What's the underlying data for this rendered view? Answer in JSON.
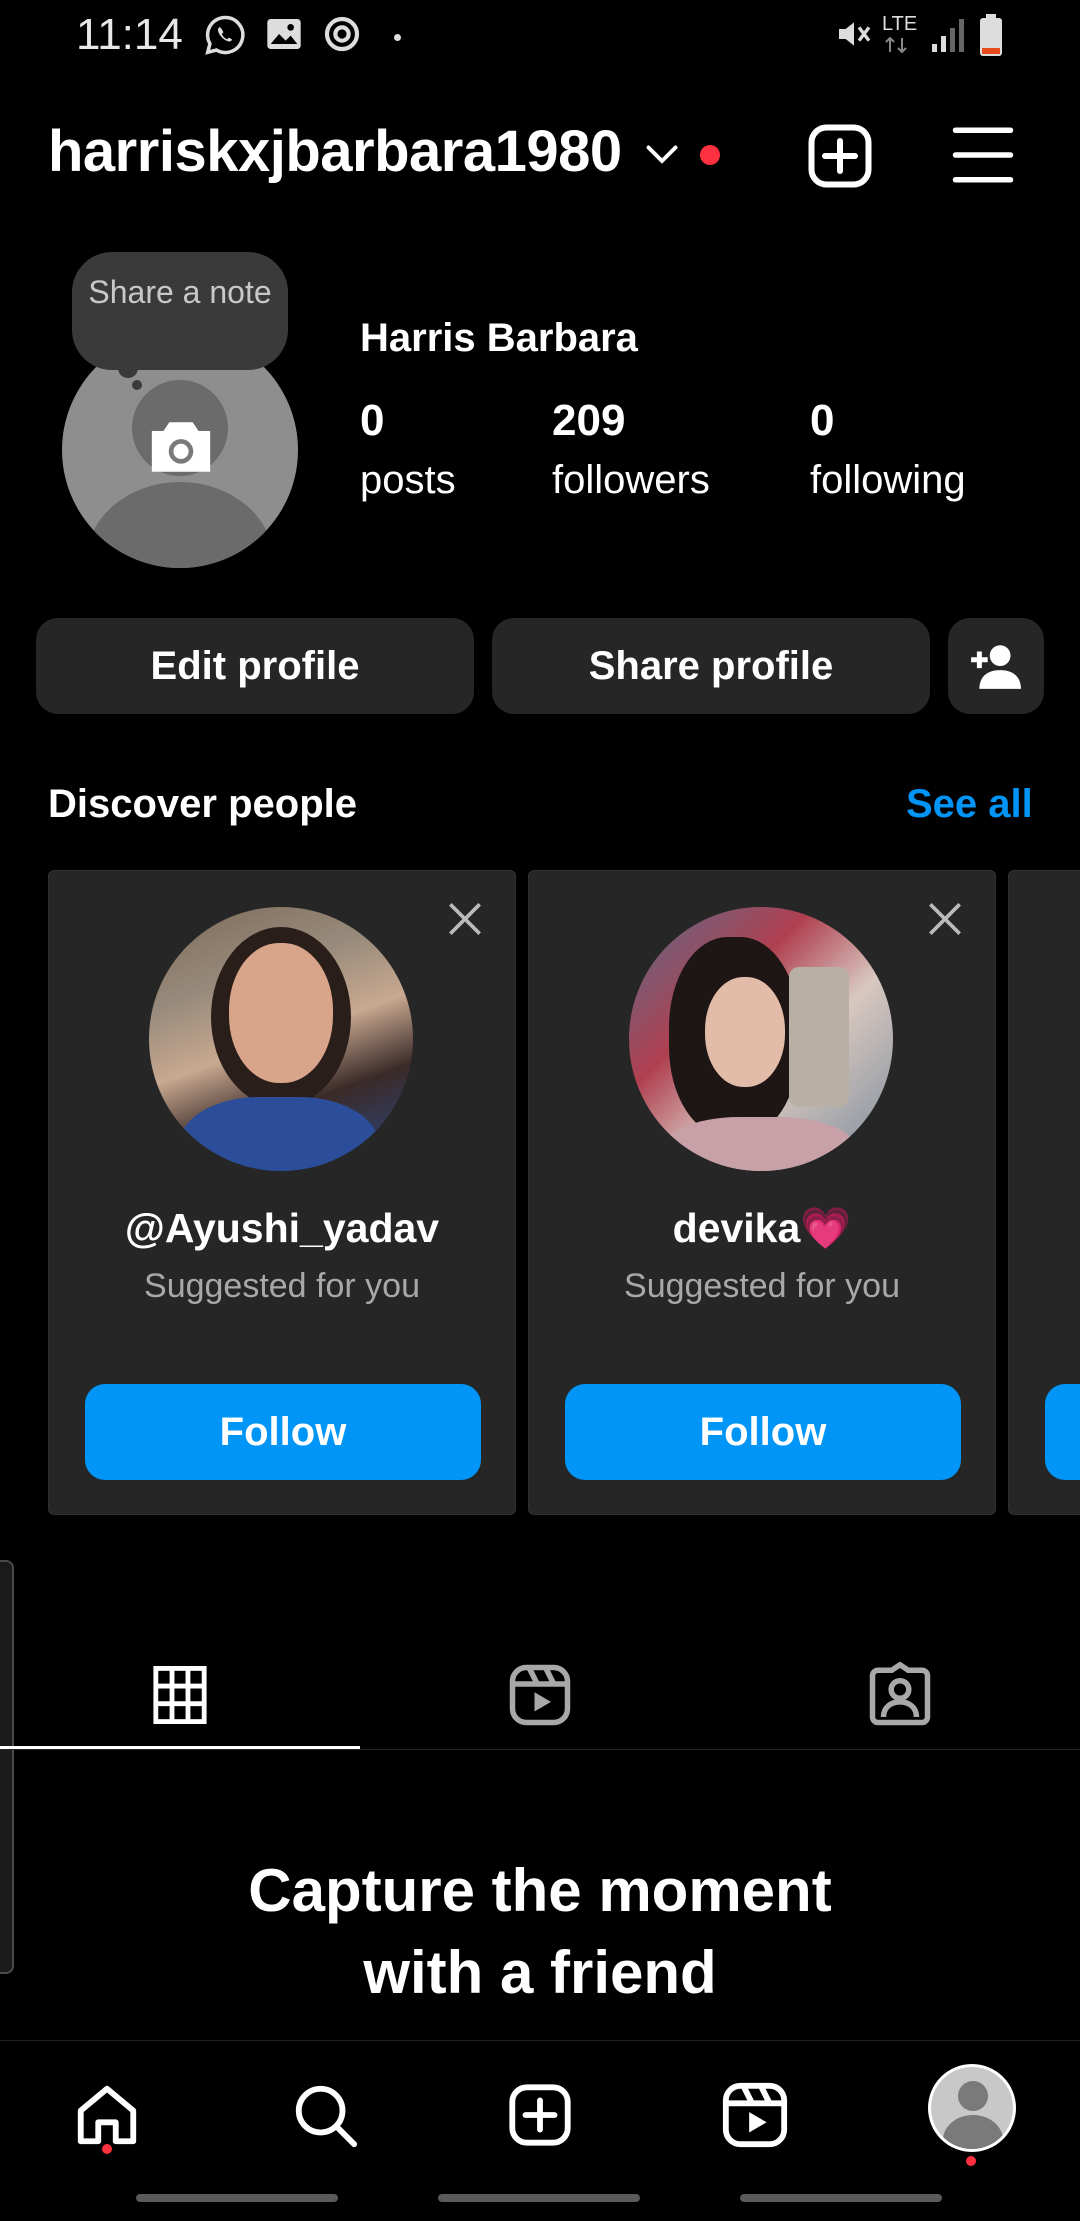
{
  "status_bar": {
    "time": "11:14",
    "network": "LTE"
  },
  "header": {
    "username": "harriskxjbarbara1980"
  },
  "profile": {
    "note_text": "Share a note",
    "display_name": "Harris Barbara",
    "stats": [
      {
        "value": "0",
        "label": "posts"
      },
      {
        "value": "209",
        "label": "followers"
      },
      {
        "value": "0",
        "label": "following"
      }
    ],
    "edit_label": "Edit profile",
    "share_label": "Share profile"
  },
  "discover": {
    "title": "Discover people",
    "see_all": "See all",
    "cards": [
      {
        "name": "@Ayushi_yadav",
        "subtitle": "Suggested for you",
        "follow": "Follow"
      },
      {
        "name": "devika💗",
        "subtitle": "Suggested for you",
        "follow": "Follow"
      }
    ]
  },
  "empty_state": {
    "title_line1": "Capture the moment",
    "title_line2": "with a friend"
  },
  "colors": {
    "accent": "#0095f6",
    "notification": "#ff3040",
    "button_dark": "#262626"
  },
  "icons": [
    "whatsapp-icon",
    "gallery-icon",
    "sync-icon",
    "mute-icon",
    "signal-icon",
    "battery-icon",
    "chevron-down-icon",
    "plus-square-icon",
    "menu-icon",
    "camera-icon",
    "add-person-icon",
    "close-icon",
    "grid-icon",
    "reels-icon",
    "tagged-icon",
    "home-icon",
    "search-icon",
    "create-icon",
    "reels-nav-icon",
    "profile-icon"
  ]
}
